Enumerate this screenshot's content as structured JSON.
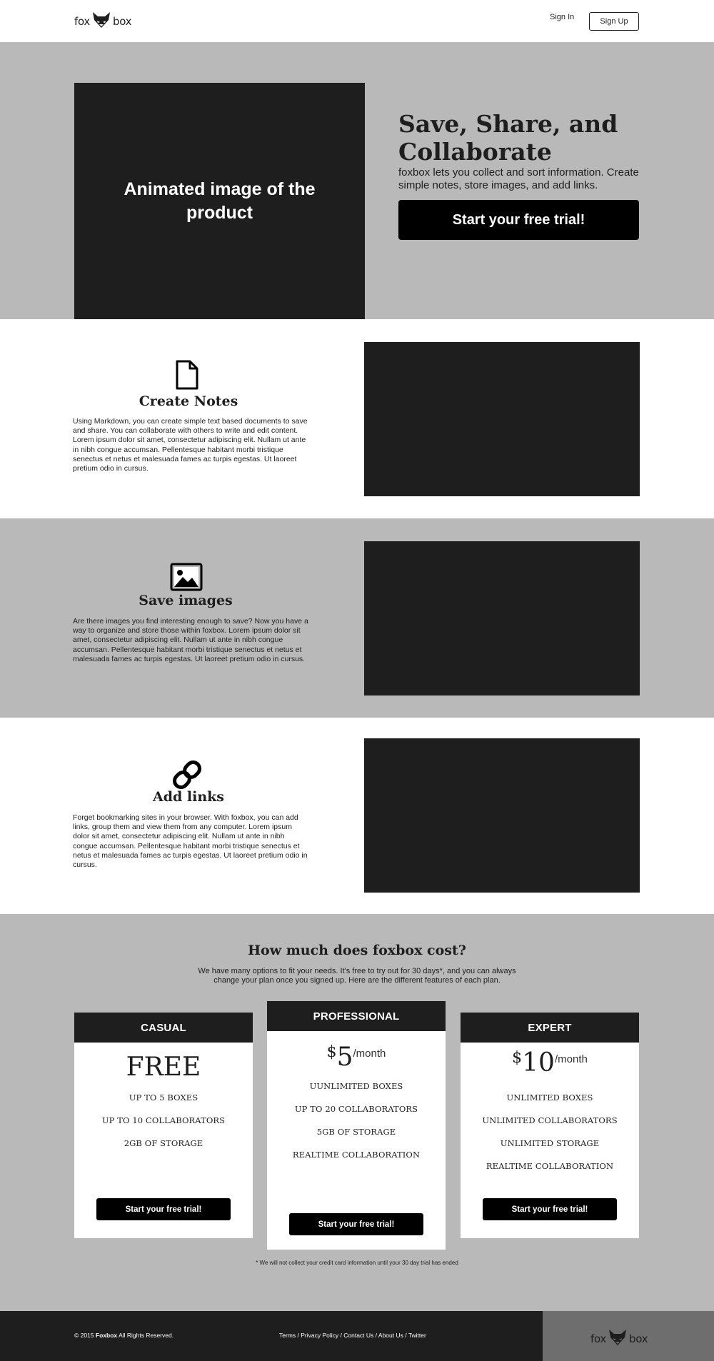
{
  "header": {
    "logo": {
      "left": "fox",
      "right": "box"
    },
    "signin_label": "Sign In",
    "signup_label": "Sign Up"
  },
  "hero": {
    "image_label": "Animated image of the product",
    "title": "Save, Share, and Collaborate",
    "subtitle": "foxbox lets you collect and sort information. Create simple notes, store images, and add links.",
    "cta_label": "Start your free trial!"
  },
  "features": [
    {
      "icon": "document-icon",
      "title": "Create Notes",
      "text": "Using Markdown, you can create simple text based documents to save and share. You can collaborate with others to write and edit content. Lorem ipsum dolor sit amet, consectetur adipiscing elit. Nullam ut ante in nibh congue accumsan. Pellentesque habitant morbi tristique senectus et netus et malesuada fames ac turpis egestas. Ut laoreet pretium odio in cursus."
    },
    {
      "icon": "image-icon",
      "title": "Save images",
      "text": "Are there images you find interesting enough to save? Now you have a way to organize and store those within foxbox. Lorem ipsum dolor sit amet, consectetur adipiscing elit. Nullam ut ante in nibh congue accumsan. Pellentesque habitant morbi tristique senectus et netus et malesuada fames ac turpis egestas. Ut laoreet pretium odio in cursus."
    },
    {
      "icon": "link-icon",
      "title": "Add links",
      "text": "Forget bookmarking sites in your browser. With foxbox, you can add links, group them and view them from any computer. Lorem ipsum dolor sit amet, consectetur adipiscing elit. Nullam ut ante in nibh congue accumsan. Pellentesque habitant morbi tristique senectus et netus et malesuada fames ac turpis egestas. Ut laoreet pretium odio in cursus."
    }
  ],
  "pricing": {
    "title": "How much does foxbox cost?",
    "subtitle": "We have many options to fit your needs. It's free to try out for 30 days*, and you can always change your plan once you signed up. Here are the different features of each plan.",
    "plans": [
      {
        "name": "CASUAL",
        "price": "FREE",
        "features": [
          "UP TO 5 BOXES",
          "UP TO 10 COLLABORATORS",
          "2GB OF STORAGE"
        ],
        "cta_label": "Start your free trial!"
      },
      {
        "name": "PROFESSIONAL",
        "currency": "$",
        "price": "5",
        "period": "/month",
        "features": [
          "UUNLIMITED BOXES",
          "UP TO 20 COLLABORATORS",
          "5GB OF STORAGE",
          "REALTIME COLLABORATION"
        ],
        "cta_label": "Start your free trial!"
      },
      {
        "name": "EXPERT",
        "currency": "$",
        "price": "10",
        "period": "/month",
        "features": [
          "UNLIMITED BOXES",
          "UNLIMITED COLLABORATORS",
          "UNLIMITED STORAGE",
          "REALTIME COLLABORATION"
        ],
        "cta_label": "Start your free trial!"
      }
    ],
    "note": "* We will not collect your credit card information until your 30 day trial has ended"
  },
  "footer": {
    "copyright_prefix": "© 2015",
    "brand": "Foxbox",
    "copyright_suffix": "All Rights Reserved.",
    "links": [
      "Terms",
      "Privacy Policy",
      "Contact Us",
      "About Us",
      "Twitter"
    ],
    "separator": " / ",
    "logo": {
      "left": "fox",
      "right": "box"
    }
  },
  "colors": {
    "dark": "#1e1e1e",
    "gray_band": "#b9b9b9",
    "footer_logo_panel": "#6e6e6e",
    "button": "#000000"
  }
}
